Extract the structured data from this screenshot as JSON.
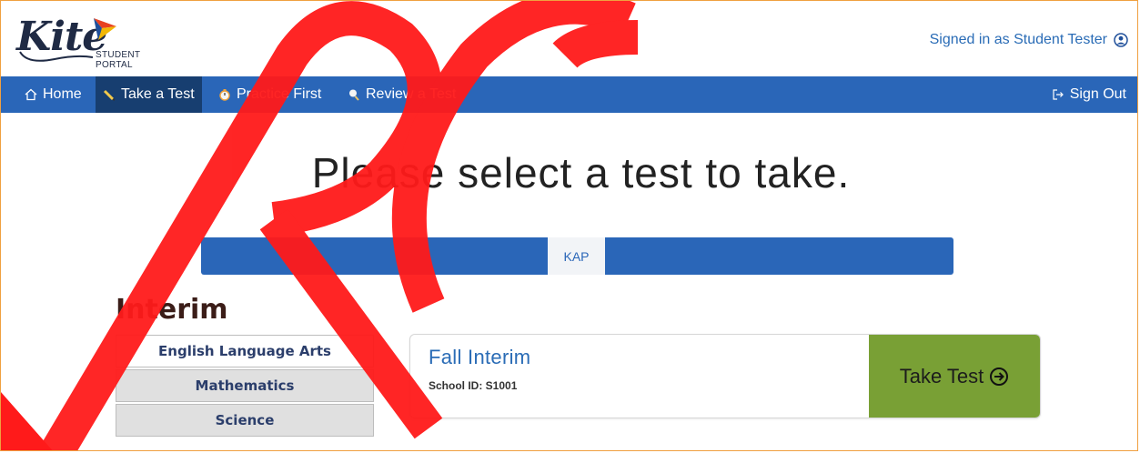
{
  "header": {
    "logo_word": "Kite",
    "logo_subtitle": "STUDENT PORTAL",
    "signed_in_text": "Signed in as Student Tester",
    "user_icon": "user-circle-icon"
  },
  "nav": {
    "items": [
      {
        "label": "Home",
        "icon": "home-icon"
      },
      {
        "label": "Take a Test",
        "icon": "pencil-icon"
      },
      {
        "label": "Practice First",
        "icon": "stopwatch-icon"
      },
      {
        "label": "Review a Test",
        "icon": "magnifier-icon"
      }
    ],
    "active": "Take a Test",
    "sign_out": {
      "label": "Sign Out",
      "icon": "sign-out-icon"
    }
  },
  "main": {
    "title": "Please select a test to take.",
    "tabs": [
      {
        "label": "KAP"
      }
    ],
    "section": "Interim",
    "subjects": [
      {
        "label": "English Language Arts"
      },
      {
        "label": "Mathematics"
      },
      {
        "label": "Science"
      }
    ],
    "active_subject": "English Language Arts",
    "test": {
      "name": "Fall Interim",
      "school_id": "School ID: S1001",
      "button_label": "Take Test",
      "button_icon": "circle-arrow-right-icon"
    }
  },
  "colors": {
    "nav_bar": "#2a66b8",
    "nav_active": "#173e70",
    "take_test_button": "#79a035",
    "link_blue": "#2a6cb6",
    "watermark_red": "#ff1a1a"
  }
}
